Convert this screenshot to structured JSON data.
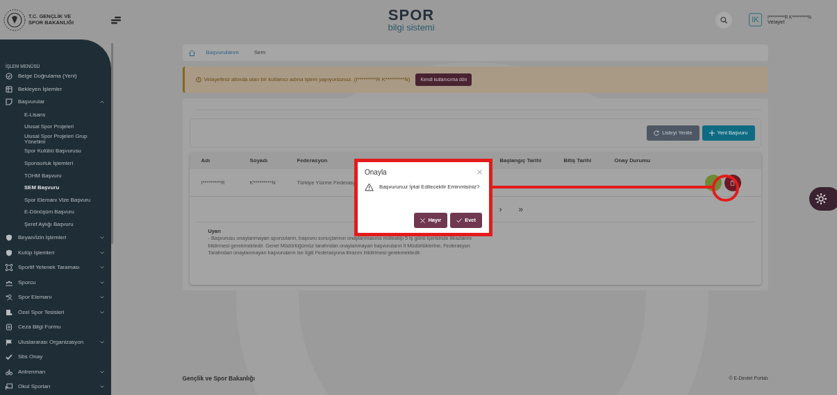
{
  "header": {
    "logo_lines": [
      "T.C. GENÇLİK VE",
      "SPOR BAKANLIĞI"
    ],
    "brand_title": "SPOR",
    "brand_subtitle": "bilgi sistemi",
    "user": {
      "initials": "IK",
      "name": "I*********R K*********N",
      "role": "Velayet"
    }
  },
  "sidebar": {
    "section_label": "İŞLEM MENÜSÜ",
    "items": [
      {
        "label": "Belge Doğrulama (Yeni)"
      },
      {
        "label": "Bekleyen İşlemler"
      },
      {
        "label": "Başvurular",
        "expanded": true,
        "children": [
          {
            "label": "E-Lisans",
            "selected": false
          },
          {
            "label": "Ulusal Spor Projeleri",
            "selected": false
          },
          {
            "label": "Ulusal Spor Projeleri Grup Yönetimi",
            "selected": false
          },
          {
            "label": "Spor Kulübü Başvurusu",
            "selected": false
          },
          {
            "label": "Sponsorluk İşlemleri",
            "selected": false
          },
          {
            "label": "TOHM Başvuru",
            "selected": false
          },
          {
            "label": "SEM Başvuru",
            "selected": true
          },
          {
            "label": "Spor Elemanı Vize Başvuru",
            "selected": false
          },
          {
            "label": "E-Dönüşüm Başvuru",
            "selected": false
          },
          {
            "label": "Şeref Aylığı Başvuru",
            "selected": false
          }
        ]
      },
      {
        "label": "Beyan/İzin İşlemleri",
        "expanded": false
      },
      {
        "label": "Kulüp İşlemleri",
        "expanded": false
      },
      {
        "label": "Sportif Yetenek Taraması",
        "expanded": false
      },
      {
        "label": "Sporcu",
        "expanded": false
      },
      {
        "label": "Spor Elemanı",
        "expanded": false
      },
      {
        "label": "Özel Spor Tesisleri",
        "expanded": false
      },
      {
        "label": "Ceza Bilgi Formu"
      },
      {
        "label": "Uluslararası Organizasyon",
        "expanded": false
      },
      {
        "label": "Sbs Onay"
      },
      {
        "label": "Antrenman",
        "expanded": false
      },
      {
        "label": "Okul Sporları",
        "expanded": false
      }
    ]
  },
  "breadcrumb": [
    {
      "label": "Başvurularım",
      "current": false
    },
    {
      "label": "Sem",
      "current": true
    }
  ],
  "alert": {
    "text": "Velayetiniz altında olan bir kullanıcı adına işlem yapıyorsunuz. (I*********R K*********N)",
    "button": "Kendi kullanıcıma dön"
  },
  "toolbar": [
    {
      "label": "Listeyi Yenile",
      "kind": "refresh"
    },
    {
      "label": "Yeni Başvuru",
      "kind": "add"
    }
  ],
  "table": {
    "columns": [
      "Adı",
      "Soyadı",
      "Federasyon",
      "Başlangıç Tarihi",
      "Bitiş Tarihi",
      "Onay Durumu"
    ],
    "rows": [
      {
        "cells": [
          "I*********R",
          "K*********N",
          "Türkiye Yüzme Federasy"
        ]
      }
    ]
  },
  "pagination": [
    "›",
    "»"
  ],
  "warning": {
    "title": "Uyarı",
    "text": "- Başvurusu onaylanmayan sporcuların, başvuru sonuçlarının onaylanmasına müteakip 5 iş günü içerisinde itirazlarını bildirmesi gerekmektedir. Genel Müdürlüğümüz tarafından onaylanmayan başvuruların İl Müdürlüklerine, Federasyon Tarafından onaylanmayan başvuruların ise İlgili Federasyona itirazını bildirimesi gerekmektedir."
  },
  "footer": {
    "left": "Gençlik ve Spor Bakanlığı",
    "right": "© E-Devlet Portalı"
  },
  "modal": {
    "title": "Onayla",
    "message": "Başvurunuz İptal Edilecektir Eminmisiniz?",
    "buttons": [
      {
        "label": "Hayır",
        "kind": "cancel"
      },
      {
        "label": "Evet",
        "kind": "confirm"
      }
    ]
  }
}
